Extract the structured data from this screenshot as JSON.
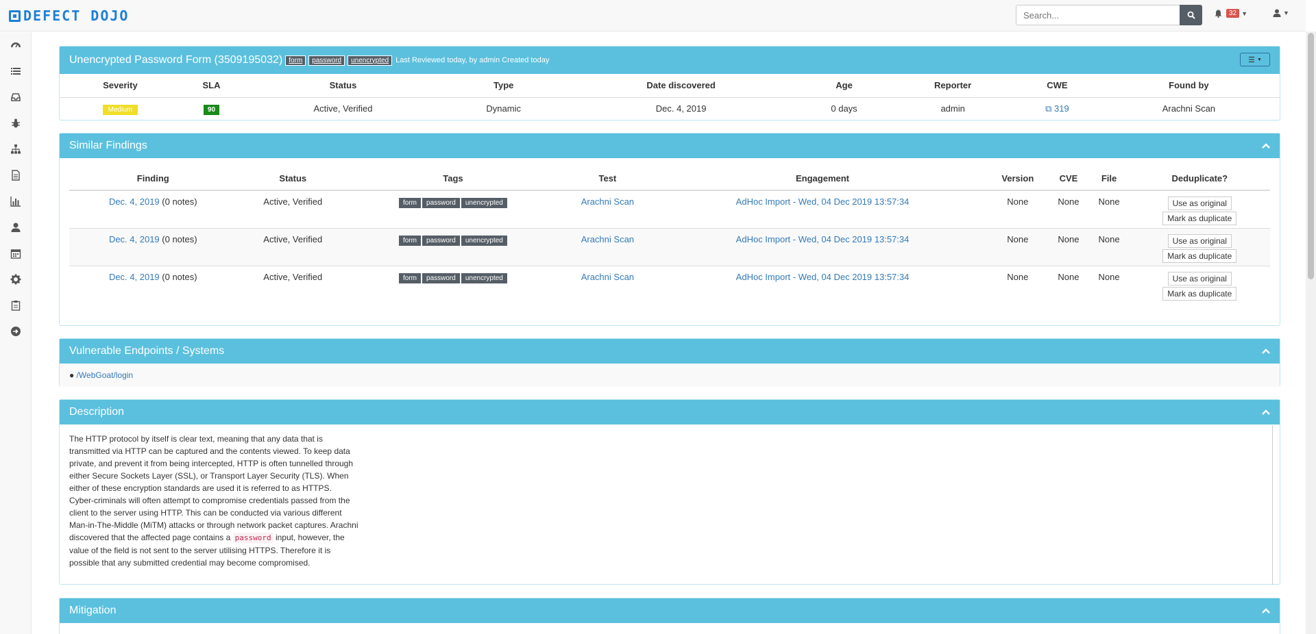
{
  "navbar": {
    "logo_text": "DEFECT DOJO",
    "search_placeholder": "Search...",
    "notification_count": "32"
  },
  "sidebar": {
    "items": [
      {
        "name": "dashboard-icon"
      },
      {
        "name": "list-icon"
      },
      {
        "name": "inbox-icon"
      },
      {
        "name": "bug-icon"
      },
      {
        "name": "sitemap-icon"
      },
      {
        "name": "file-icon"
      },
      {
        "name": "bar-chart-icon"
      },
      {
        "name": "user-icon"
      },
      {
        "name": "calendar-icon"
      },
      {
        "name": "gear-icon"
      },
      {
        "name": "clipboard-icon"
      },
      {
        "name": "sign-out-icon"
      }
    ]
  },
  "finding": {
    "title": "Unencrypted Password Form (3509195032)",
    "tags": [
      "form",
      "password",
      "unencrypted"
    ],
    "meta": "Last Reviewed today, by admin  Created today",
    "headers": [
      "Severity",
      "SLA",
      "Status",
      "Type",
      "Date discovered",
      "Age",
      "Reporter",
      "CWE",
      "Found by"
    ],
    "severity": "Medium",
    "sla": "90",
    "status": "Active, Verified",
    "type": "Dynamic",
    "date_discovered": "Dec. 4, 2019",
    "age": "0 days",
    "reporter": "admin",
    "cwe": "319",
    "found_by": "Arachni Scan"
  },
  "similar": {
    "title": "Similar Findings",
    "headers": [
      "Finding",
      "Status",
      "Tags",
      "Test",
      "Engagement",
      "Version",
      "CVE",
      "File",
      "Deduplicate?"
    ],
    "use_original_label": "Use as original",
    "mark_duplicate_label": "Mark as duplicate",
    "rows": [
      {
        "date": "Dec. 4, 2019",
        "notes": "(0 notes)",
        "status": "Active, Verified",
        "tags": [
          "form",
          "password",
          "unencrypted"
        ],
        "test": "Arachni Scan",
        "engagement": "AdHoc Import - Wed, 04 Dec 2019 13:57:34",
        "version": "None",
        "cve": "None",
        "file": "None"
      },
      {
        "date": "Dec. 4, 2019",
        "notes": "(0 notes)",
        "status": "Active, Verified",
        "tags": [
          "form",
          "password",
          "unencrypted"
        ],
        "test": "Arachni Scan",
        "engagement": "AdHoc Import - Wed, 04 Dec 2019 13:57:34",
        "version": "None",
        "cve": "None",
        "file": "None"
      },
      {
        "date": "Dec. 4, 2019",
        "notes": "(0 notes)",
        "status": "Active, Verified",
        "tags": [
          "form",
          "password",
          "unencrypted"
        ],
        "test": "Arachni Scan",
        "engagement": "AdHoc Import - Wed, 04 Dec 2019 13:57:34",
        "version": "None",
        "cve": "None",
        "file": "None"
      }
    ]
  },
  "endpoints": {
    "title": "Vulnerable Endpoints / Systems",
    "items": [
      "/WebGoat/login"
    ]
  },
  "description": {
    "title": "Description",
    "text_before": "The HTTP protocol by itself is clear text, meaning that any data that is transmitted via HTTP can be captured and the contents viewed. To keep data private, and prevent it from being intercepted, HTTP is often tunnelled through either Secure Sockets Layer (SSL), or Transport Layer Security (TLS). When either of these encryption standards are used it is referred to as HTTPS. Cyber-criminals will often attempt to compromise credentials passed from the client to the server using HTTP. This can be conducted via various different Man-in-The-Middle (MiTM) attacks or through network packet captures. Arachni discovered that the affected page contains a",
    "code": "password",
    "text_after": "input, however, the value of the field is not sent to the server utilising HTTPS. Therefore it is possible that any submitted credential may become compromised."
  },
  "mitigation": {
    "title": "Mitigation"
  }
}
